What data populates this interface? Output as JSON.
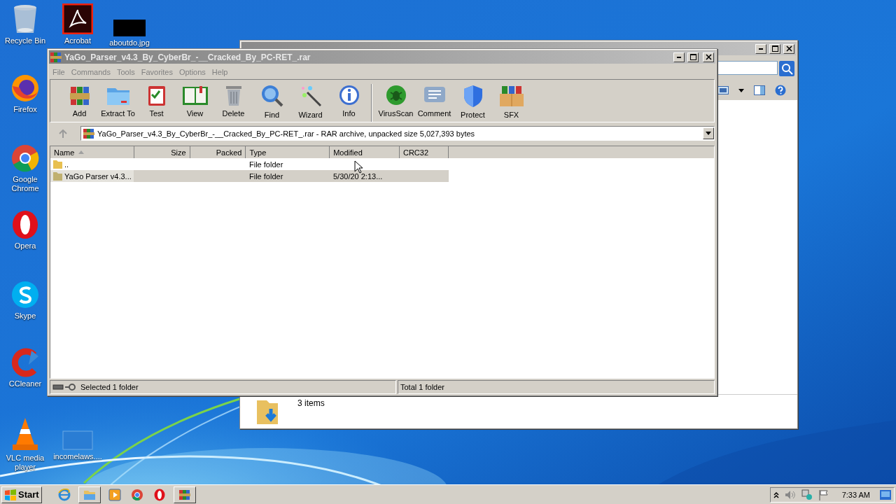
{
  "desktop": {
    "icons": [
      {
        "label": "Recycle Bin"
      },
      {
        "label": "Acrobat"
      },
      {
        "label": "aboutdo.jpg"
      },
      {
        "label": "Firefox"
      },
      {
        "label": "Google Chrome"
      },
      {
        "label": "Opera"
      },
      {
        "label": "Skype"
      },
      {
        "label": "CCleaner"
      },
      {
        "label": "VLC media player"
      },
      {
        "label": "incomelaws...."
      }
    ]
  },
  "archive_window": {
    "title": "YaGo_Parser_v4.3_By_CyberBr_-__Cracked_By_PC-RET_.rar",
    "menu": [
      "File",
      "Commands",
      "Tools",
      "Favorites",
      "Options",
      "Help"
    ],
    "toolbar": [
      {
        "label": "Add"
      },
      {
        "label": "Extract To"
      },
      {
        "label": "Test"
      },
      {
        "label": "View"
      },
      {
        "label": "Delete"
      },
      {
        "label": "Find"
      },
      {
        "label": "Wizard"
      },
      {
        "label": "Info"
      },
      {
        "label": "VirusScan"
      },
      {
        "label": "Comment"
      },
      {
        "label": "Protect"
      },
      {
        "label": "SFX"
      }
    ],
    "address": "YaGo_Parser_v4.3_By_CyberBr_-__Cracked_By_PC-RET_.rar - RAR archive, unpacked size 5,027,393 bytes",
    "columns": [
      {
        "label": "Name",
        "sorted": true
      },
      {
        "label": "Size",
        "sorted": false
      },
      {
        "label": "Packed",
        "sorted": false
      },
      {
        "label": "Type",
        "sorted": false
      },
      {
        "label": "Modified",
        "sorted": false
      },
      {
        "label": "CRC32",
        "sorted": false
      }
    ],
    "rows": [
      {
        "name": "..",
        "type": "File folder",
        "selected": false
      },
      {
        "name": "YaGo Parser v4.3...",
        "type": "File folder",
        "modified": "5/30/20 2:13...",
        "selected": true
      }
    ],
    "status_left": "Selected 1 folder",
    "status_right": "Total 1 folder"
  },
  "explorer_window": {
    "status": "3 items"
  },
  "taskbar": {
    "start": "Start",
    "clock": "7:33 AM"
  }
}
